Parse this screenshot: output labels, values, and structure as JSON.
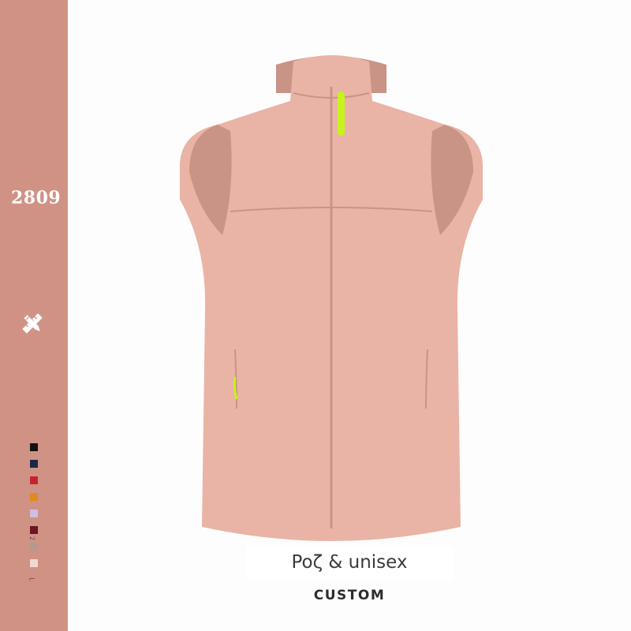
{
  "theme": {
    "sidebar_color": "#cf9285",
    "garment_color": "#e9b3a5",
    "garment_shadow": "#c99385",
    "zipper_pull_color": "#c8f21d"
  },
  "sidebar": {
    "code": "2809",
    "tools_icon": "pencil-ruler-icon",
    "swatches": [
      "#111111",
      "#1c2744",
      "#c8232b",
      "#e0891f",
      "#cdbfe0",
      "#6a1424",
      "#b59a8c",
      "#f1d9d2"
    ],
    "size_marks": [
      "2",
      "L"
    ]
  },
  "product": {
    "image": "pink fleece zip-up vest"
  },
  "caption": {
    "title": "Poζ & unisex",
    "subtitle": "CUSTOM"
  }
}
